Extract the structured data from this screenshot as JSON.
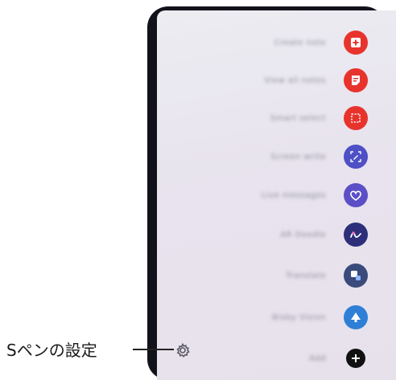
{
  "callout": {
    "label": "Sペンの設定"
  },
  "air_command": {
    "items": [
      {
        "label": "Create note",
        "icon": "new-note-icon",
        "color": "#e8332d"
      },
      {
        "label": "View all notes",
        "icon": "notes-list-icon",
        "color": "#e8332d"
      },
      {
        "label": "Smart select",
        "icon": "smart-select-icon",
        "color": "#e8332d"
      },
      {
        "label": "Screen write",
        "icon": "screen-write-icon",
        "color": "#4f4fc6"
      },
      {
        "label": "Live messages",
        "icon": "live-message-heart-icon",
        "color": "#5a4fc6"
      },
      {
        "label": "AR Doodle",
        "icon": "ar-doodle-icon",
        "color": "#2d2f7a"
      },
      {
        "label": "Translate",
        "icon": "translate-icon",
        "color": "#3a4a7a"
      },
      {
        "label": "Bixby Vision",
        "icon": "bixby-vision-icon",
        "color": "#2f7fd6"
      },
      {
        "label": "Add",
        "icon": "add-shortcut-icon",
        "color": "#111111"
      }
    ],
    "settings_icon": "gear-icon"
  }
}
